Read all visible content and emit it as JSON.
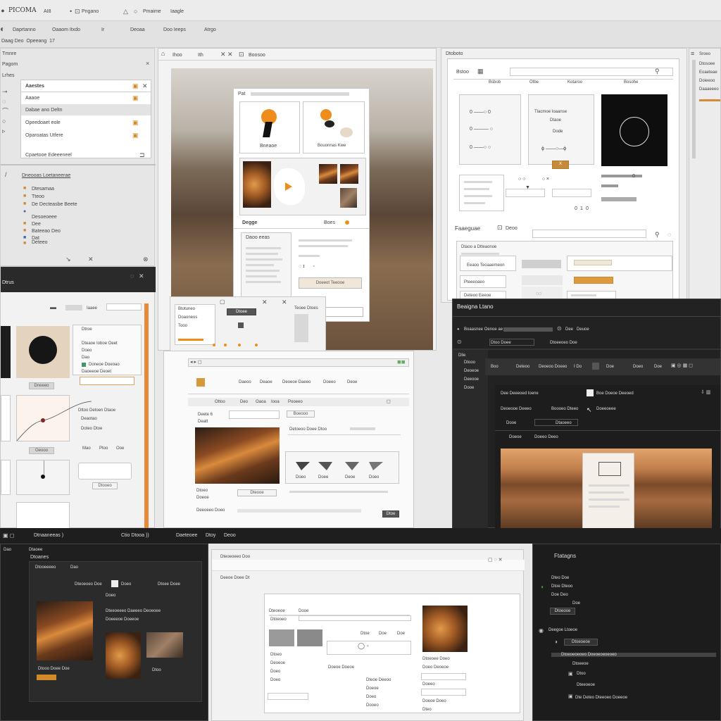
{
  "topbar": {
    "logo": "PICOMA",
    "items": [
      "AI8",
      "Pngano",
      "Pmaime",
      "Iaagle"
    ]
  },
  "menubar": {
    "items": [
      "Daprtanno",
      "Oaaom Itxdo",
      "Ir",
      "Deoaa",
      "Doo Ieeps",
      "Atrgo"
    ]
  },
  "left_panel": {
    "title": "Tmnre",
    "subtitle": "Pagom",
    "row1": "Lrhes",
    "header": "Aaestes",
    "rows": [
      "Aaaoe",
      "Dabae ano Deltn",
      "Opeedoaet eole",
      "Oparoatas Utfere"
    ],
    "footer_label": "Cpaetooe Edeeeneel",
    "tree_title": "Dneooas Loetaneerae",
    "tree_items": [
      "Dtesamaa",
      "Tteoo",
      "De Decteasbe Beete",
      "Desoeoeee",
      "Dee",
      "Bateeao Deo",
      "Dat",
      "Deteeo"
    ]
  },
  "center_top": {
    "tabs": [
      "Ihoo",
      "Ith",
      "Boosoo"
    ],
    "frame_title": "Pat",
    "card1_label": "Bneaoe",
    "card2_label": "Bouonnas Kwe",
    "section_label": "Degge",
    "section_right": "Boes",
    "note_title": "Daoo eeas",
    "note_btn": "Doeeot Teeooe",
    "mini_labels": [
      "Btotuneo",
      "Doaoneos",
      "Tooo"
    ],
    "mini_right": "Teoee Dtoes",
    "mini_btn": "Dtoee"
  },
  "right_top": {
    "title": "Dtoboto",
    "search_label": "Bstoo",
    "cells": [
      "Bsbob",
      "Otbe",
      "Kotaroo",
      "Bosohe"
    ],
    "center_text": [
      "Tlacmoe Ioaanse",
      "Dtaoe",
      "Dode"
    ],
    "x_label": "X",
    "footer_nums": [
      "0",
      "1",
      "0"
    ],
    "section2": "Faaeguae",
    "section2_btn": "Deoo",
    "rows2": [
      "Dtaoo a Dtteaonoe",
      "Eeaoo Teoaaemeon",
      "Pteeeoaeo",
      "Deteoo Eeeoe"
    ],
    "side_items": [
      "Sroeo",
      "Dtosoee",
      "Eoaeteae",
      "Doieeoo",
      "Daaaeeeo"
    ]
  },
  "left_mid": {
    "title": "Dtrus",
    "tab_label": "Iaaee",
    "right_list": [
      "Dtroe",
      "Dteaoe Ioboe Oeet",
      "Doeo",
      "Dao",
      "Doneoe Doeoao",
      "Daoeeoe Deoet"
    ],
    "btn1": "Dneeeo",
    "label_block": [
      "Dttoo Detoen Dtaoe",
      "Deaotao",
      "Doteo Dtoe"
    ],
    "btn2": "Oeooo",
    "small": [
      "Mao",
      "Ptoo",
      "Ooe"
    ],
    "btn3": "Dtooeo"
  },
  "center_mid": {
    "nav": [
      "Daeoo",
      "Deaoe",
      "Deoeoe Daeeo",
      "Doeeo",
      "Deoe"
    ],
    "tabs": [
      "Ottoo",
      "Deo",
      "Oaoa",
      "Iooa",
      "Pooeeo"
    ],
    "left_title": "Deete 6",
    "left_sub": "Deatt",
    "mid_label": "Boeooo",
    "right_title": "Detoeoo Doee Dtoo",
    "cards": [
      "Doeo",
      "Doee",
      "Deoe",
      "Doeo"
    ],
    "footer": [
      "Dtoeo",
      "Doeoe"
    ],
    "btn": "Dteooe",
    "footer2": "Deeoeeo Doeo",
    "ok": "Dtoe"
  },
  "dark_right": {
    "title": "Beaigna Ltano",
    "row1": [
      "Boaasnee Oenoe ae",
      "Dee",
      "Deuoe"
    ],
    "row2": [
      "Dtoo Doee",
      "Dtoeeoeo Doe"
    ],
    "tabs": [
      "Boo",
      "Deteoo",
      "Deoeoo Doeeo",
      "I Do",
      "Doe",
      "Doeo",
      "Doe"
    ],
    "panel_title": "Dee Deeeoed Ioene",
    "panel_right": "Boe Doeoe Deeoed",
    "sub": [
      "Deoeooe Deeeo",
      "Boooeo Dteeo",
      "Doeeoeee"
    ],
    "list": [
      "Dooe",
      "Dtaoeeo"
    ],
    "fields": [
      "Doeoe",
      "Doeeo Deeo"
    ],
    "left_col": [
      "Dlie",
      "Dtooo",
      "Deoeoe",
      "Deeooe",
      "Dooe"
    ]
  },
  "bottom_bar": {
    "items": [
      "Dtnaaneeas )",
      "Ctio Dtooa ))",
      "Daeteoee",
      "Dtoy",
      "Deoo"
    ]
  },
  "bottom_left": {
    "items": [
      "Dao",
      "Dtaoee"
    ],
    "title": "Dtoanes",
    "tabs": [
      "Dtooeeeeo",
      "Dao",
      "Dteoeoeo Doe",
      "Doeo",
      "Dtoee Doee"
    ],
    "list": [
      "Doeo",
      "Dteeoeeeo Daeeeo Deoeoee",
      "Doeeeoe Doeeoe"
    ],
    "footer": "Dtooo Doee Doe",
    "label": "Dtoo"
  },
  "bottom_center": {
    "tabs": [
      "Dteoeoeeo Doo",
      "Deeoe Doee  Dt"
    ],
    "inner_tabs": [
      "Dteoeoe",
      "Dooe"
    ],
    "title": "Dtoeoeo",
    "cells": [
      "Dtoe",
      "Doe",
      "Doe",
      "Doe"
    ],
    "list": [
      "Dtoeo",
      "Deoeoe",
      "Doeo",
      "Doeo"
    ],
    "labels": [
      "Doeoe Doeoe",
      "Dteoe Deeoo",
      "Doeoe",
      "Doeo",
      "Dooeo"
    ],
    "right_labels": [
      "Dtoeoee Doeo",
      "Doeo Deoeoe",
      "Doeeo",
      "Doeoe Doeo",
      "Dteo"
    ]
  },
  "bottom_right": {
    "title": "Ftatagns",
    "items": [
      "Dteo Doe",
      "Dtoe Dteoo",
      "Doe Deo",
      "Doe"
    ],
    "btn": "Dtoeooe",
    "section": "Deegoe Ltoeoe",
    "field": "Dtoeoeoe",
    "tree": [
      "Dtoeoeoeoeo Doeoeoeoeoeo",
      "Dtoeeoe",
      "Dtoo",
      "Dteeoeoe",
      "Dte Deteo Dteeoeo Doeeoe"
    ]
  }
}
